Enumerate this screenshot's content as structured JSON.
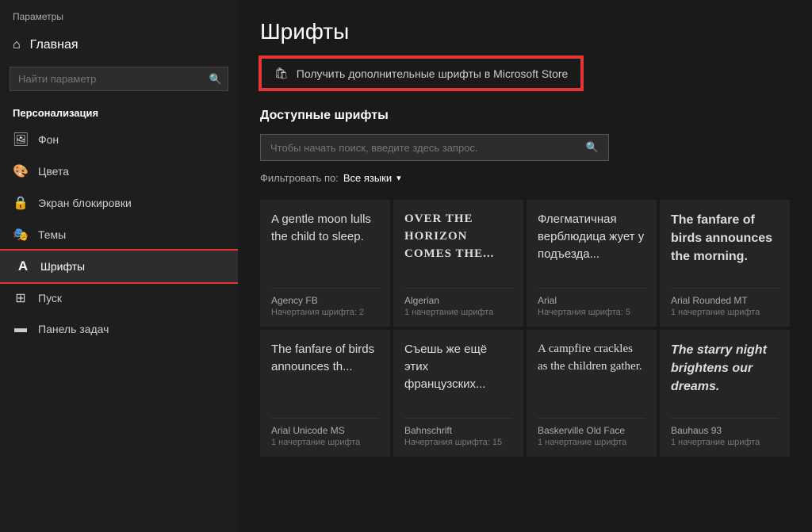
{
  "app": {
    "title": "Параметры"
  },
  "sidebar": {
    "home_label": "Главная",
    "search_placeholder": "Найти параметр",
    "section_title": "Персонализация",
    "items": [
      {
        "id": "fon",
        "label": "Фон",
        "icon": "🖼"
      },
      {
        "id": "cveta",
        "label": "Цвета",
        "icon": "🎨"
      },
      {
        "id": "ekran",
        "label": "Экран блокировки",
        "icon": "🔒"
      },
      {
        "id": "temy",
        "label": "Темы",
        "icon": "🎭"
      },
      {
        "id": "shrifty",
        "label": "Шрифты",
        "icon": "A",
        "active": true
      },
      {
        "id": "pusk",
        "label": "Пуск",
        "icon": "⊞"
      },
      {
        "id": "panel",
        "label": "Панель задач",
        "icon": "▬"
      }
    ]
  },
  "main": {
    "page_title": "Шрифты",
    "store_button_label": "Получить дополнительные шрифты в Microsoft Store",
    "store_icon": "🛍",
    "available_fonts_title": "Доступные шрифты",
    "search_placeholder": "Чтобы начать поиск, введите здесь запрос.",
    "filter_label": "Фильтровать по:",
    "filter_value": "Все языки",
    "font_cards": [
      {
        "preview_text": "A gentle moon lulls the child to sleep.",
        "font_name": "Agency FB",
        "font_styles": "Начертания шрифта: 2",
        "font_class": "font-agency"
      },
      {
        "preview_text": "OVER THE HORIZON COMES THE...",
        "font_name": "Algerian",
        "font_styles": "1 начертание шрифта",
        "font_class": "font-algerian"
      },
      {
        "preview_text": "Флегматичная верблюдица жует у подъезда...",
        "font_name": "Arial",
        "font_styles": "Начертания шрифта: 5",
        "font_class": "font-arial"
      },
      {
        "preview_text": "The fanfare of birds announces the morning.",
        "font_name": "Arial Rounded MT",
        "font_styles": "1 начертание шрифта",
        "font_class": "font-arial-rounded"
      },
      {
        "preview_text": "The fanfare of birds announces th...",
        "font_name": "Arial Unicode MS",
        "font_styles": "1 начертание шрифта",
        "font_class": "font-arial-unicode"
      },
      {
        "preview_text": "Съешь же ещё этих французских...",
        "font_name": "Bahnschrift",
        "font_styles": "Начертания шрифта: 15",
        "font_class": "font-bahnschrift"
      },
      {
        "preview_text": "A campfire crackles as the children gather.",
        "font_name": "Baskerville Old Face",
        "font_styles": "1 начертание шрифта",
        "font_class": "font-baskerville"
      },
      {
        "preview_text": "The starry night brightens our dreams.",
        "font_name": "Bauhaus 93",
        "font_styles": "1 начертание шрифта",
        "font_class": "font-bauhaus"
      }
    ]
  }
}
